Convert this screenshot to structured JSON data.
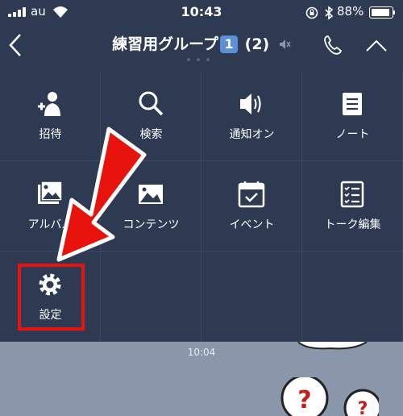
{
  "status_bar": {
    "carrier": "au",
    "time": "10:43",
    "battery": "88%",
    "icons": [
      "signal-icon",
      "wifi-icon",
      "rotation-lock-icon",
      "bluetooth-icon",
      "battery-icon"
    ]
  },
  "nav": {
    "title_prefix": "練習用グループ",
    "title_badge": "1",
    "member_count": "(2)",
    "icons": [
      "back-icon",
      "mute-icon",
      "phone-icon",
      "collapse-icon"
    ]
  },
  "menu": {
    "items": [
      {
        "label": "招待",
        "icon": "invite-icon"
      },
      {
        "label": "検索",
        "icon": "search-icon"
      },
      {
        "label": "通知オン",
        "icon": "speaker-icon"
      },
      {
        "label": "ノート",
        "icon": "note-icon"
      },
      {
        "label": "アルバム",
        "icon": "album-icon"
      },
      {
        "label": "コンテンツ",
        "icon": "contents-icon"
      },
      {
        "label": "イベント",
        "icon": "event-icon"
      },
      {
        "label": "トーク編集",
        "icon": "talk-edit-icon"
      },
      {
        "label": "設定",
        "icon": "gear-icon"
      }
    ]
  },
  "chat": {
    "time": "10:04"
  },
  "colors": {
    "panel": "#2d3a52",
    "chat_bg": "#8a96aa",
    "highlight": "#e8130d"
  }
}
